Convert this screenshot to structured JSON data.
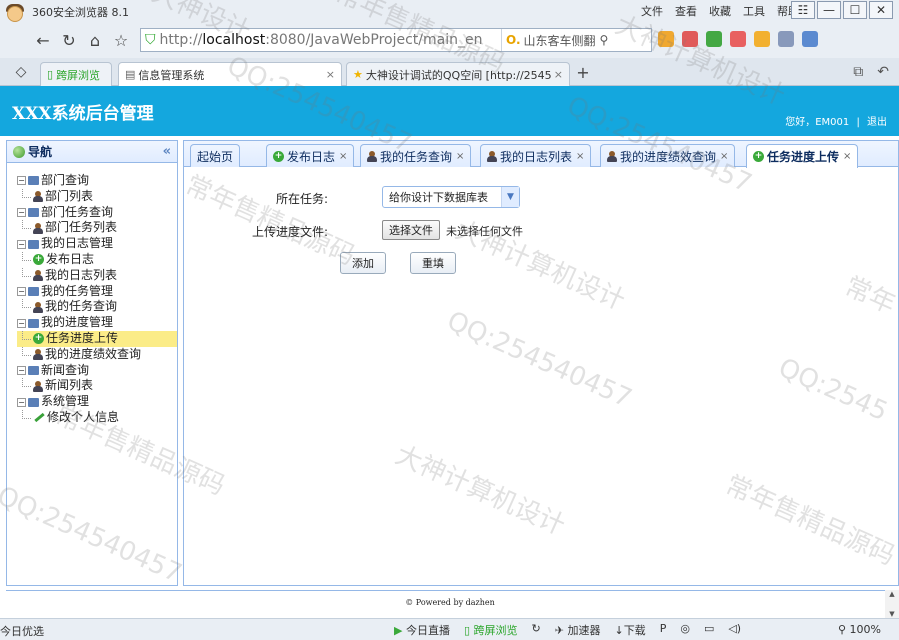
{
  "browser": {
    "app_title": "360安全浏览器 8.1",
    "top_menu": [
      "文件",
      "查看",
      "收藏",
      "工具",
      "帮助"
    ],
    "window_controls": [
      "☷",
      "—",
      "☐",
      "✕"
    ],
    "address_prefix": "http://",
    "address_host": "localhost",
    "address_rest": ":8080/JavaWebProject/main_en",
    "search_text": "山东客车侧翻",
    "tabs": [
      {
        "label": "跨屏浏览"
      },
      {
        "label": "信息管理系统",
        "active": true
      },
      {
        "label": "大神设计调试的QQ空间 [http://2545"
      }
    ],
    "new_tab": "+"
  },
  "header": {
    "logo": "XXX系统后台管理",
    "greeting": "您好，EM001",
    "separator": "|",
    "logout": "退出"
  },
  "nav": {
    "title": "导航",
    "collapse": "«",
    "tree": [
      {
        "label": "部门查询",
        "children": [
          {
            "label": "部门列表",
            "icon": "user-icon"
          }
        ]
      },
      {
        "label": "部门任务查询",
        "children": [
          {
            "label": "部门任务列表",
            "icon": "user-icon"
          }
        ]
      },
      {
        "label": "我的日志管理",
        "children": [
          {
            "label": "发布日志",
            "icon": "plus-circle-icon"
          },
          {
            "label": "我的日志列表",
            "icon": "user-icon"
          }
        ]
      },
      {
        "label": "我的任务管理",
        "children": [
          {
            "label": "我的任务查询",
            "icon": "user-icon"
          }
        ]
      },
      {
        "label": "我的进度管理",
        "children": [
          {
            "label": "任务进度上传",
            "icon": "plus-circle-icon",
            "selected": true
          },
          {
            "label": "我的进度绩效查询",
            "icon": "user-icon"
          }
        ]
      },
      {
        "label": "新闻查询",
        "children": [
          {
            "label": "新闻列表",
            "icon": "user-icon"
          }
        ]
      },
      {
        "label": "系统管理",
        "children": [
          {
            "label": "修改个人信息",
            "icon": "pencil-icon"
          }
        ]
      }
    ]
  },
  "content_tabs": [
    {
      "label": "起始页",
      "icon": "",
      "closable": false
    },
    {
      "label": "发布日志",
      "icon": "plus-circle-icon",
      "closable": true
    },
    {
      "label": "我的任务查询",
      "icon": "user-icon",
      "closable": true
    },
    {
      "label": "我的日志列表",
      "icon": "user-icon",
      "closable": true
    },
    {
      "label": "我的进度绩效查询",
      "icon": "user-icon",
      "closable": true
    },
    {
      "label": "任务进度上传",
      "icon": "plus-circle-icon",
      "closable": true,
      "active": true
    }
  ],
  "form": {
    "task_label": "所在任务:",
    "task_value": "给你设计下数据库表",
    "file_label": "上传进度文件:",
    "file_button": "选择文件",
    "file_state": "未选择任何文件",
    "add_button": "添加",
    "reset_button": "重填"
  },
  "footer": {
    "text": "© Powered by dazhen"
  },
  "statusbar": {
    "left": "今日优选",
    "live": "今日直播",
    "cross": "跨屏浏览",
    "accelerator": "加速器",
    "download": "下载",
    "zoom": "100%"
  },
  "watermarks": [
    "大神设计",
    "常年售精品源码",
    "QQ:254540457",
    "大神计算机设计",
    "常年售精品源码",
    "QQ:254540457",
    "QQ:254540457",
    "大神计算机设计",
    "常年售精品源码",
    "QQ:254540457",
    "常年售精品源码",
    "大神计算机设计",
    "QQ:2545",
    "常年"
  ]
}
